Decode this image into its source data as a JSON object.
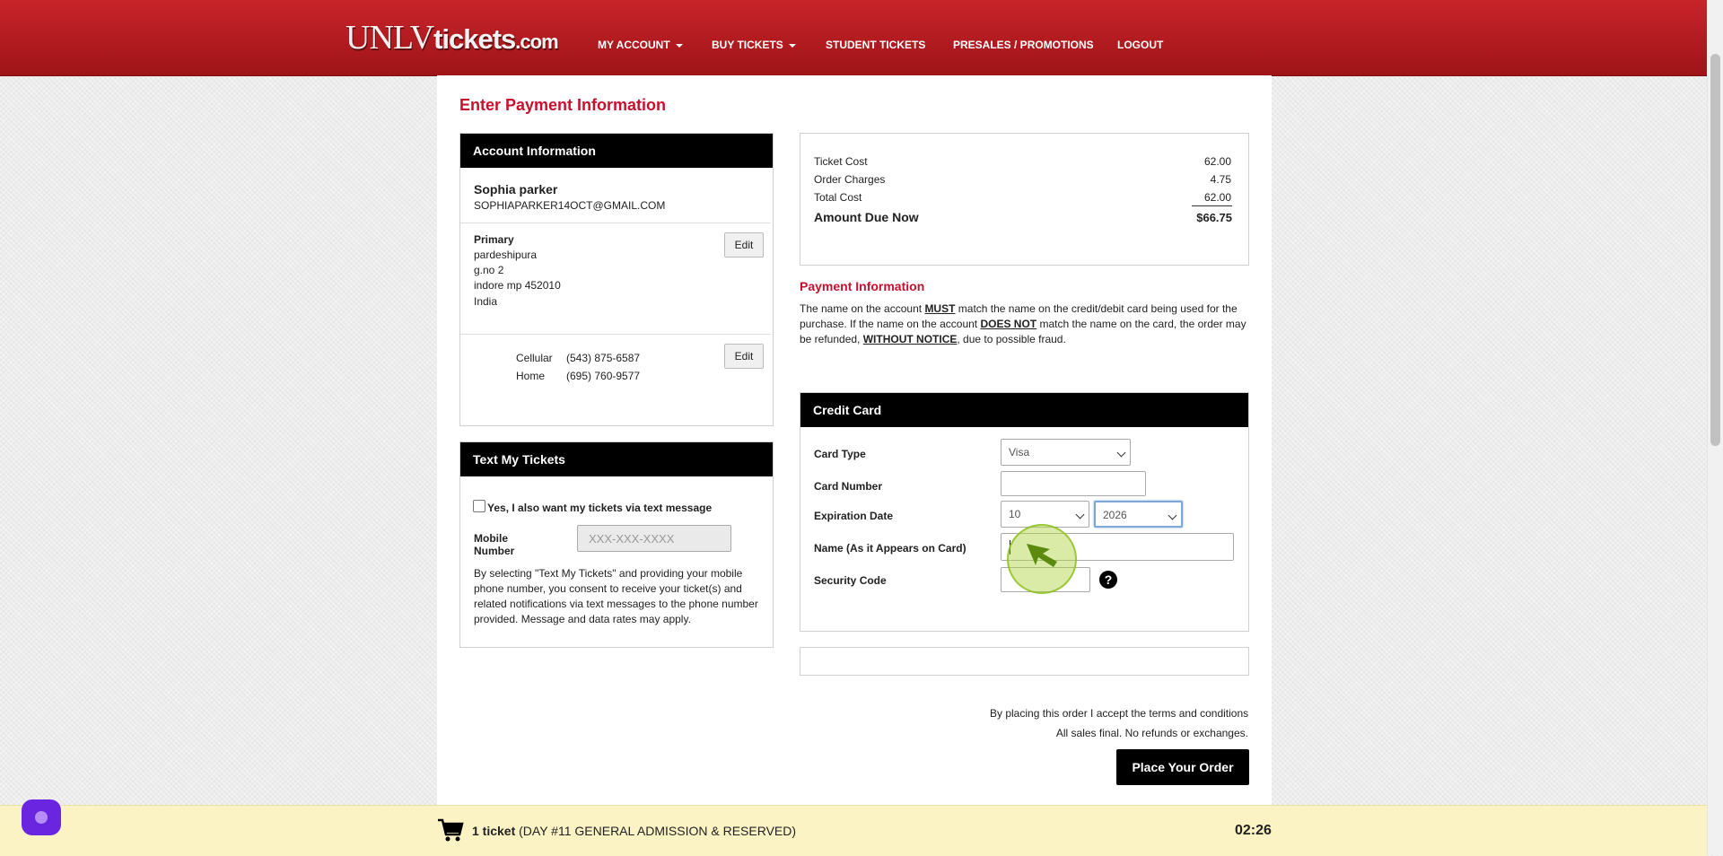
{
  "header": {
    "logo": {
      "part1": "UNLV",
      "part2": "tickets",
      "part3": ".com"
    },
    "nav": [
      {
        "label": "MY ACCOUNT",
        "dropdown": true
      },
      {
        "label": "BUY TICKETS",
        "dropdown": true
      },
      {
        "label": "STUDENT TICKETS",
        "dropdown": false
      },
      {
        "label": "PRESALES / PROMOTIONS",
        "dropdown": false
      },
      {
        "label": "LOGOUT",
        "dropdown": false
      }
    ]
  },
  "page_title": "Enter Payment Information",
  "account": {
    "heading": "Account Information",
    "name": "Sophia parker",
    "email": "SOPHIAPARKER14OCT@GMAIL.COM",
    "address": {
      "label": "Primary",
      "line1": "pardeshipura",
      "line2": "g.no 2",
      "line3": "indore mp 452010",
      "country": "India"
    },
    "edit_label": "Edit",
    "phones": [
      {
        "type": "Cellular",
        "number": "(543) 875-6587"
      },
      {
        "type": "Home",
        "number": "(695) 760-9577"
      }
    ]
  },
  "text_tickets": {
    "heading": "Text My Tickets",
    "checkbox_label": "Yes, I also want my tickets via text message",
    "mobile_label_1": "Mobile",
    "mobile_label_2": "Number",
    "mobile_placeholder": "XXX-XXX-XXXX",
    "consent_1": "By selecting \"Text My Tickets\" and providing your mobile",
    "consent_2": "phone number, you consent to receive your ticket(s) and",
    "consent_3": "related notifications via text messages to the phone number",
    "consent_4": "provided. Message and data rates may apply."
  },
  "summary": {
    "rows": [
      {
        "label": "Ticket Cost",
        "value": "62.00"
      },
      {
        "label": "Order Charges",
        "value": "4.75"
      },
      {
        "label": "Total Cost",
        "value": "62.00"
      }
    ],
    "due_label": "Amount Due Now",
    "due_value": "$66.75"
  },
  "payment_info": {
    "heading": "Payment Information",
    "l1_a": "The name on the account ",
    "l1_b": "MUST",
    "l1_c": " match the name on the credit/debit card being used for the",
    "l2_a": "purchase. If the name on the account ",
    "l2_b": "DOES NOT",
    "l2_c": " match the name on the card, the order may",
    "l3_a": "be refunded, ",
    "l3_b": "WITHOUT NOTICE",
    "l3_c": ", due to possible fraud."
  },
  "credit_card": {
    "heading": "Credit Card",
    "card_type_label": "Card Type",
    "card_type_value": "Visa",
    "card_number_label": "Card Number",
    "card_number_value": "",
    "exp_label": "Expiration Date",
    "exp_month": "10",
    "exp_year": "2026",
    "name_label": "Name (As it Appears on Card)",
    "name_value": "",
    "security_label": "Security Code",
    "security_value": "",
    "help_glyph": "?"
  },
  "terms": {
    "line1": "By placing this order I accept the terms and conditions",
    "line2": "All sales final. No refunds or exchanges.",
    "place_order": "Place Your Order"
  },
  "cart_bar": {
    "count": "1 ticket",
    "detail": "(DAY #11 GENERAL ADMISSION & RESERVED)",
    "timer": "02:26",
    "icon": "cart-icon"
  },
  "colors": {
    "brand_red": "#c8102e",
    "header_red": "#b51d22",
    "cart_bar_bg": "#fbf3c4",
    "chat_purple": "#6a25e0"
  }
}
